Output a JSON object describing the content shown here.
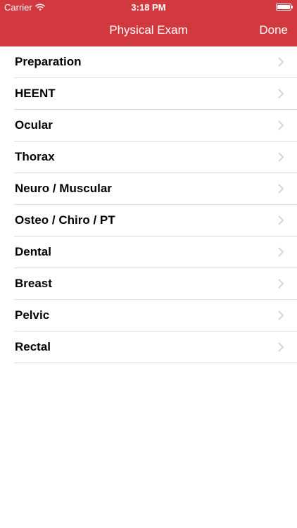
{
  "status_bar": {
    "carrier": "Carrier",
    "time": "3:18 PM"
  },
  "nav": {
    "title": "Physical Exam",
    "done_label": "Done"
  },
  "colors": {
    "accent": "#d1393e",
    "separator": "#dcdcdc",
    "chevron": "#c7c7cc"
  },
  "items": [
    {
      "label": "Preparation"
    },
    {
      "label": "HEENT"
    },
    {
      "label": "Ocular"
    },
    {
      "label": "Thorax"
    },
    {
      "label": "Neuro / Muscular"
    },
    {
      "label": "Osteo / Chiro / PT"
    },
    {
      "label": "Dental"
    },
    {
      "label": "Breast"
    },
    {
      "label": "Pelvic"
    },
    {
      "label": "Rectal"
    }
  ]
}
